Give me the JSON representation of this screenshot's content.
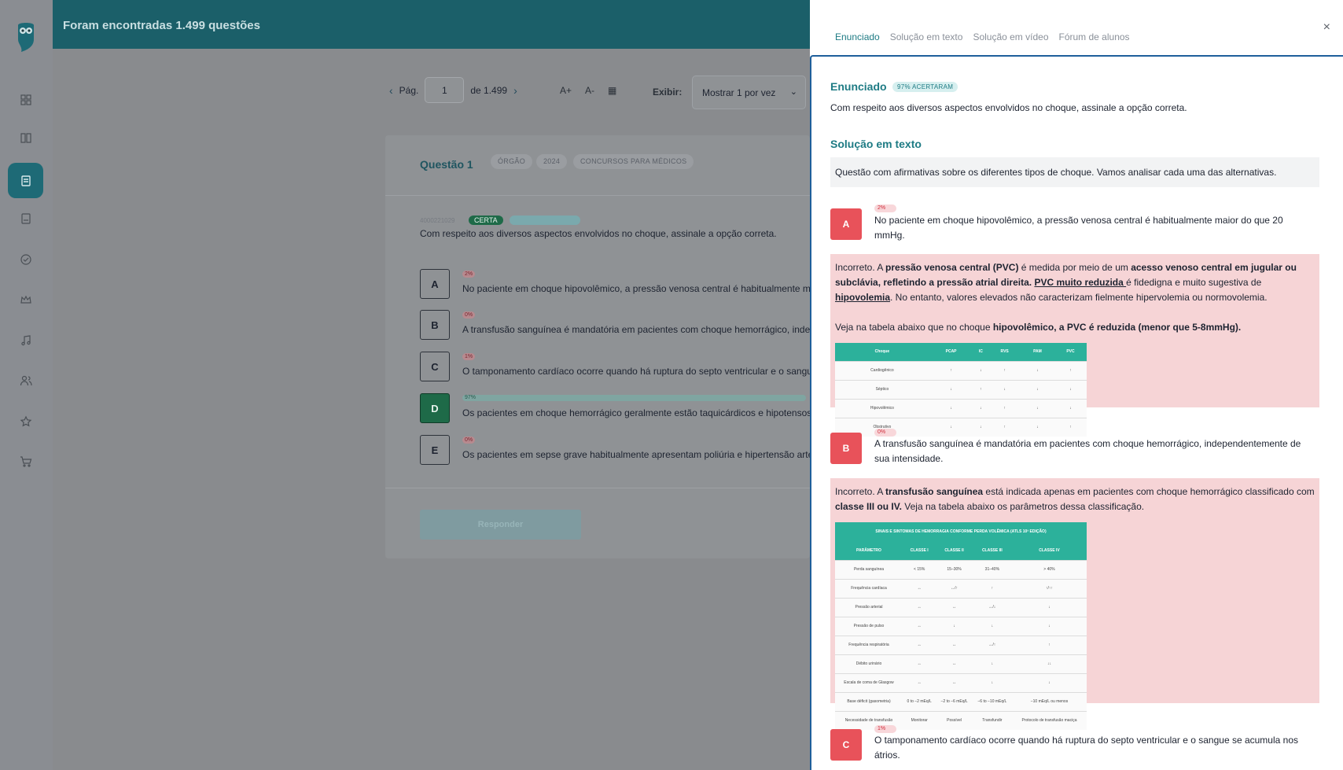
{
  "header": {
    "title": "Foram encontradas 1.499 questões"
  },
  "pager": {
    "prev": "‹",
    "label": "Pág.",
    "page": "1",
    "of": "de 1.499",
    "next": "›",
    "font_up": "A+",
    "font_down": "A-",
    "display_label": "Exibir:",
    "display_value": "Mostrar 1 por vez"
  },
  "question": {
    "title": "Questão 1",
    "tags": [
      "ÓRGÃO",
      "2024",
      "CONCURSOS PARA MÉDICOS"
    ],
    "id": "4000221029",
    "status": "CERTA",
    "stem": "Com respeito aos diversos aspectos envolvidos no choque, assinale a opção correta.",
    "options": [
      {
        "letter": "A",
        "pct": "2%",
        "text": "No paciente em choque hipovolêmico, a pressão venosa central é habitualmente maior do que 20 mmHg."
      },
      {
        "letter": "B",
        "pct": "0%",
        "text": "A transfusão sanguínea é mandatória em pacientes com choque hemorrágico, independentemente de sua intensidade."
      },
      {
        "letter": "C",
        "pct": "1%",
        "text": "O tamponamento cardíaco ocorre quando há ruptura do septo ventricular e o sangue se acumula nos átrios."
      },
      {
        "letter": "D",
        "pct": "97%",
        "text": "Os pacientes em choque hemorrágico geralmente estão taquicárdicos e hipotensos."
      },
      {
        "letter": "E",
        "pct": "0%",
        "text": "Os pacientes em sepse grave habitualmente apresentam poliúria e hipertensão arterial."
      }
    ],
    "submit_label": "Responder"
  },
  "panel": {
    "tabs": [
      "Enunciado",
      "Solução em texto",
      "Solução em vídeo",
      "Fórum de alunos"
    ],
    "close": "×",
    "enunciado_title": "Enunciado",
    "enunciado_badge": "97% ACERTARAM",
    "enunciado_text": "Com respeito aos diversos aspectos envolvidos no choque, assinale a opção correta.",
    "solucao_title": "Solução em texto",
    "solucao_intro": "Questão com afirmativas sobre os diferentes tipos de choque. Vamos analisar cada uma das alternativas.",
    "alt_a": {
      "letter": "A",
      "pct": "2%",
      "text": "No paciente em choque hipovolêmico, a pressão venosa central é habitualmente maior do que 20 mmHg.",
      "exp_1": "Incorreto. A ",
      "exp_2": "pressão venosa central (PVC)",
      "exp_3": " é medida por meio de um ",
      "exp_4": "acesso venoso central em jugular ou subclávia, refletindo a pressão atrial direita.",
      "exp_5": " ",
      "exp_6": "PVC muito reduzida ",
      "exp_7": "é fidedigna e muito sugestiva de ",
      "exp_8": "hipovolemia",
      "exp_9": ". No entanto, valores elevados não caracterizam fielmente hipervolemia ou normovolemia.",
      "exp_10": "Veja na tabela abaixo que no choque ",
      "exp_11": "hipovolêmico, a PVC é reduzida (menor que 5-8mmHg).",
      "table": {
        "headers": [
          "Choque",
          "PCAP",
          "IC",
          "RVS",
          "PAM",
          "PVC"
        ],
        "rows": [
          [
            "Cardiogênico",
            "↑",
            "↓",
            "↑",
            "↓",
            "↑"
          ],
          [
            "Séptico",
            "↓",
            "↑",
            "↓",
            "↓",
            "↓"
          ],
          [
            "Hipovolêmico",
            "↓",
            "↓",
            "↑",
            "↓",
            "↓"
          ],
          [
            "Obstrutivo",
            "↓",
            "↓",
            "↑",
            "↓",
            "↑"
          ]
        ]
      }
    },
    "alt_b": {
      "letter": "B",
      "pct": "0%",
      "text": "A transfusão sanguínea é mandatória em pacientes com choque hemorrágico, independentemente de sua intensidade.",
      "exp_1": "Incorreto. A ",
      "exp_2": "transfusão sanguínea",
      "exp_3": " está indicada apenas em pacientes com choque hemorrágico classificado com ",
      "exp_4": "classe III ou IV.",
      "exp_5": " Veja na tabela abaixo os parâmetros dessa classificação.",
      "table": {
        "caption": "SINAIS E SINTOMAS DE HEMORRAGIA CONFORME PERDA VOLÊMICA (ATLS 10ª EDIÇÃO)",
        "headers": [
          "PARÂMETRO",
          "CLASSE I",
          "CLASSE II",
          "CLASSE III",
          "CLASSE IV"
        ],
        "rows": [
          [
            "Perda sanguínea",
            "< 15%",
            "15–30%",
            "31–40%",
            "> 40%"
          ],
          [
            "Frequência cardíaca",
            "↔",
            "↔/↑",
            "↑",
            "↑/↑↑"
          ],
          [
            "Pressão arterial",
            "↔",
            "↔",
            "↔/↓",
            "↓"
          ],
          [
            "Pressão de pulso",
            "↔",
            "↓",
            "↓",
            "↓"
          ],
          [
            "Frequência respiratória",
            "↔",
            "↔",
            "↔/↑",
            "↑"
          ],
          [
            "Débito urinário",
            "↔",
            "↔",
            "↓",
            "↓↓"
          ],
          [
            "Escala de coma de Glasgow",
            "↔",
            "↔",
            "↓",
            "↓"
          ],
          [
            "Base déficit (gasometria)",
            "0 to −2 mEq/L",
            "−2 to −6 mEq/L",
            "−6 to −10 mEq/L",
            "−10 mEq/L ou menos"
          ],
          [
            "Necessidade de transfusão",
            "Monitorar",
            "Possível",
            "Transfundir",
            "Protocolo de transfusão maciça"
          ]
        ]
      }
    },
    "alt_c": {
      "letter": "C",
      "pct": "1%",
      "text": "O tamponamento cardíaco ocorre quando há ruptura do septo ventricular e o sangue se acumula nos átrios."
    }
  },
  "colors": {
    "accent": "#1e7b84",
    "wrong": "#e8525a",
    "wrong_bg": "#f6d4d6",
    "correct": "#1e6a48"
  }
}
